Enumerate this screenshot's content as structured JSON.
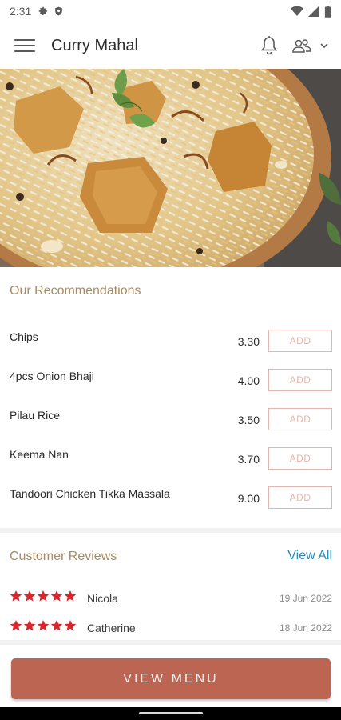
{
  "status_bar": {
    "time": "2:31"
  },
  "app_bar": {
    "title": "Curry Mahal"
  },
  "recommendations": {
    "title": "Our Recommendations",
    "add_label": "ADD",
    "items": [
      {
        "name": "Chips",
        "price": "3.30"
      },
      {
        "name": "4pcs Onion Bhaji",
        "price": "4.00"
      },
      {
        "name": "Pilau Rice",
        "price": "3.50"
      },
      {
        "name": "Keema Nan",
        "price": "3.70"
      },
      {
        "name": "Tandoori Chicken Tikka Massala",
        "price": "9.00"
      }
    ]
  },
  "reviews": {
    "title": "Customer Reviews",
    "view_all": "View All",
    "items": [
      {
        "name": "Nicola",
        "date": "19 Jun 2022",
        "stars": 5
      },
      {
        "name": "Catherine",
        "date": "18 Jun 2022",
        "stars": 5
      }
    ]
  },
  "footer": {
    "view_menu": "VIEW MENU"
  },
  "colors": {
    "accent": "#bb6552",
    "section_title": "#a78b63",
    "link": "#2a8ab8",
    "star": "#d9252c",
    "add_border": "#e3b6ae"
  }
}
